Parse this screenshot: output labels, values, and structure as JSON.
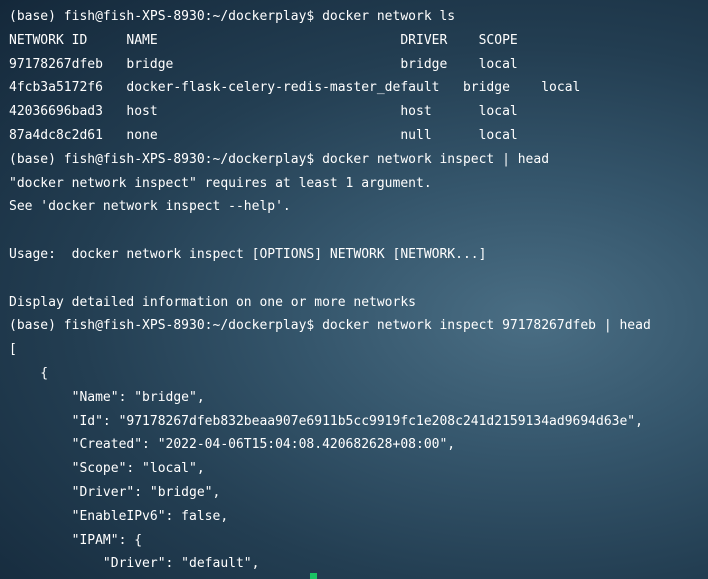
{
  "terminal": {
    "lines": [
      "(base) fish@fish-XPS-8930:~/dockerplay$ docker network ls",
      "NETWORK ID     NAME                               DRIVER    SCOPE",
      "97178267dfeb   bridge                             bridge    local",
      "4fcb3a5172f6   docker-flask-celery-redis-master_default   bridge    local",
      "42036696bad3   host                               host      local",
      "87a4dc8c2d61   none                               null      local",
      "(base) fish@fish-XPS-8930:~/dockerplay$ docker network inspect | head",
      "\"docker network inspect\" requires at least 1 argument.",
      "See 'docker network inspect --help'.",
      "",
      "Usage:  docker network inspect [OPTIONS] NETWORK [NETWORK...]",
      "",
      "Display detailed information on one or more networks",
      "(base) fish@fish-XPS-8930:~/dockerplay$ docker network inspect 97178267dfeb | head",
      "[",
      "    {",
      "        \"Name\": \"bridge\",",
      "        \"Id\": \"97178267dfeb832beaa907e6911b5cc9919fc1e208c241d2159134ad9694d63e\",",
      "        \"Created\": \"2022-04-06T15:04:08.420682628+08:00\",",
      "        \"Scope\": \"local\",",
      "        \"Driver\": \"bridge\",",
      "        \"EnableIPv6\": false,",
      "        \"IPAM\": {",
      "            \"Driver\": \"default\","
    ]
  },
  "colors": {
    "text": "#ffffff",
    "cursor": "#19c464"
  }
}
